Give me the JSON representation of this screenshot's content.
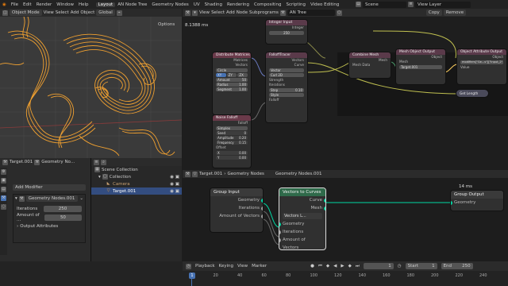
{
  "menus": [
    "File",
    "Edit",
    "Render",
    "Window",
    "Help"
  ],
  "workspaces": [
    "Layout",
    "AN Node Tree",
    "Geometry Nodes",
    "UV",
    "Shading",
    "Rendering",
    "Compositing",
    "Scripting",
    "Video Editing"
  ],
  "active_workspace": "Layout",
  "scene": "Scene",
  "view_layer": "View Layer",
  "viewport": {
    "mode": "Object Mode",
    "menus": [
      "View",
      "Select",
      "Add",
      "Object"
    ],
    "orientation": "Global",
    "options": "Options"
  },
  "an_editor": {
    "menus": [
      "View",
      "Select",
      "Add",
      "Node",
      "Subprograms"
    ],
    "tree": "AN Tree",
    "copy": "Copy",
    "remove": "Remove",
    "timing": "8.1388 ms",
    "info": "23 ms"
  },
  "an_nodes": {
    "integer_input": {
      "title": "Integer Input",
      "label": "Integer",
      "values": [
        "250",
        "250"
      ]
    },
    "distribute": {
      "title": "Distribute Matrices",
      "rows": [
        "Matrices",
        "Vectors"
      ],
      "fields": [
        "Circle",
        "XY",
        "ZY",
        "ZX"
      ],
      "amount": [
        "Amount",
        "50"
      ],
      "radius": [
        "Radius",
        "1.00"
      ],
      "segment": [
        "Segment",
        "1.00"
      ]
    },
    "falloff_tracer": {
      "title": "FalloffTracer",
      "rows": [
        "Vectors",
        "Curve"
      ],
      "fields": [
        "Vector",
        "Curl 2D"
      ],
      "strengths": [
        "Strength",
        "Iterations"
      ],
      "step": [
        "Step",
        "0.10"
      ],
      "style": [
        "Style"
      ],
      "falloff": "Falloff"
    },
    "noise_falloff": {
      "title": "Noise Falloff",
      "type": "Simplex",
      "rows": [
        [
          "Seed",
          "0"
        ],
        [
          "Amplitude",
          "0.20"
        ],
        [
          "Frequency",
          "0.15"
        ],
        [
          "Offset",
          ""
        ],
        [
          "X",
          "0.00"
        ],
        [
          "Y",
          "0.00"
        ]
      ],
      "out": "Falloff"
    },
    "combine_mesh": {
      "title": "Combine Mesh",
      "rows": [
        "Mesh",
        "Mesh Data"
      ]
    },
    "mesh_object_output": {
      "title": "Mesh Object Output",
      "rows": [
        "Object",
        "Mesh",
        "Target.001"
      ]
    },
    "object_attr_output": {
      "title": "Object Attribute Output",
      "rows": [
        "Object",
        "modifiers[\"Ge...s\"][\"Input_2\"]",
        "Value"
      ]
    },
    "get_length": {
      "title": "Get Length"
    }
  },
  "properties": {
    "object": "Target.001",
    "modifier_tab": "Geometry No...",
    "add_modifier": "Add Modifier",
    "modifier_name": "Geometry Nodes.001",
    "iterations_label": "Iterations",
    "iterations_value": "250",
    "amount_label": "Amount of ...",
    "amount_value": "50",
    "output_attrs": "Output Attributes"
  },
  "outliner": {
    "root": "Scene Collection",
    "items": [
      "Collection",
      "Camera",
      "Target.001"
    ]
  },
  "gn_editor": {
    "object": "Target.001",
    "tree": "Geometry Nodes",
    "tree_name": "Geometry Nodes.001",
    "time": "14 ms",
    "group_input": {
      "title": "Group Input",
      "rows": [
        "Geometry",
        "Iterations",
        "Amount of Vectors"
      ]
    },
    "vectors_to_curves": {
      "title": "Vectors to Curves",
      "outs": [
        "Curve",
        "Mesh"
      ],
      "ins": [
        "Vectors L...",
        "Geometry",
        "Iterations",
        "Amount of Vectors"
      ]
    },
    "group_output": {
      "title": "Group Output",
      "rows": [
        "Geometry"
      ]
    }
  },
  "timeline": {
    "menus": [
      "Playback",
      "Keying",
      "View",
      "Marker"
    ],
    "current": "1",
    "start_label": "Start",
    "start": "1",
    "end_label": "End",
    "end": "250",
    "ticks": [
      "1",
      "20",
      "40",
      "60",
      "80",
      "100",
      "120",
      "140",
      "160",
      "180",
      "200",
      "220",
      "240"
    ]
  }
}
